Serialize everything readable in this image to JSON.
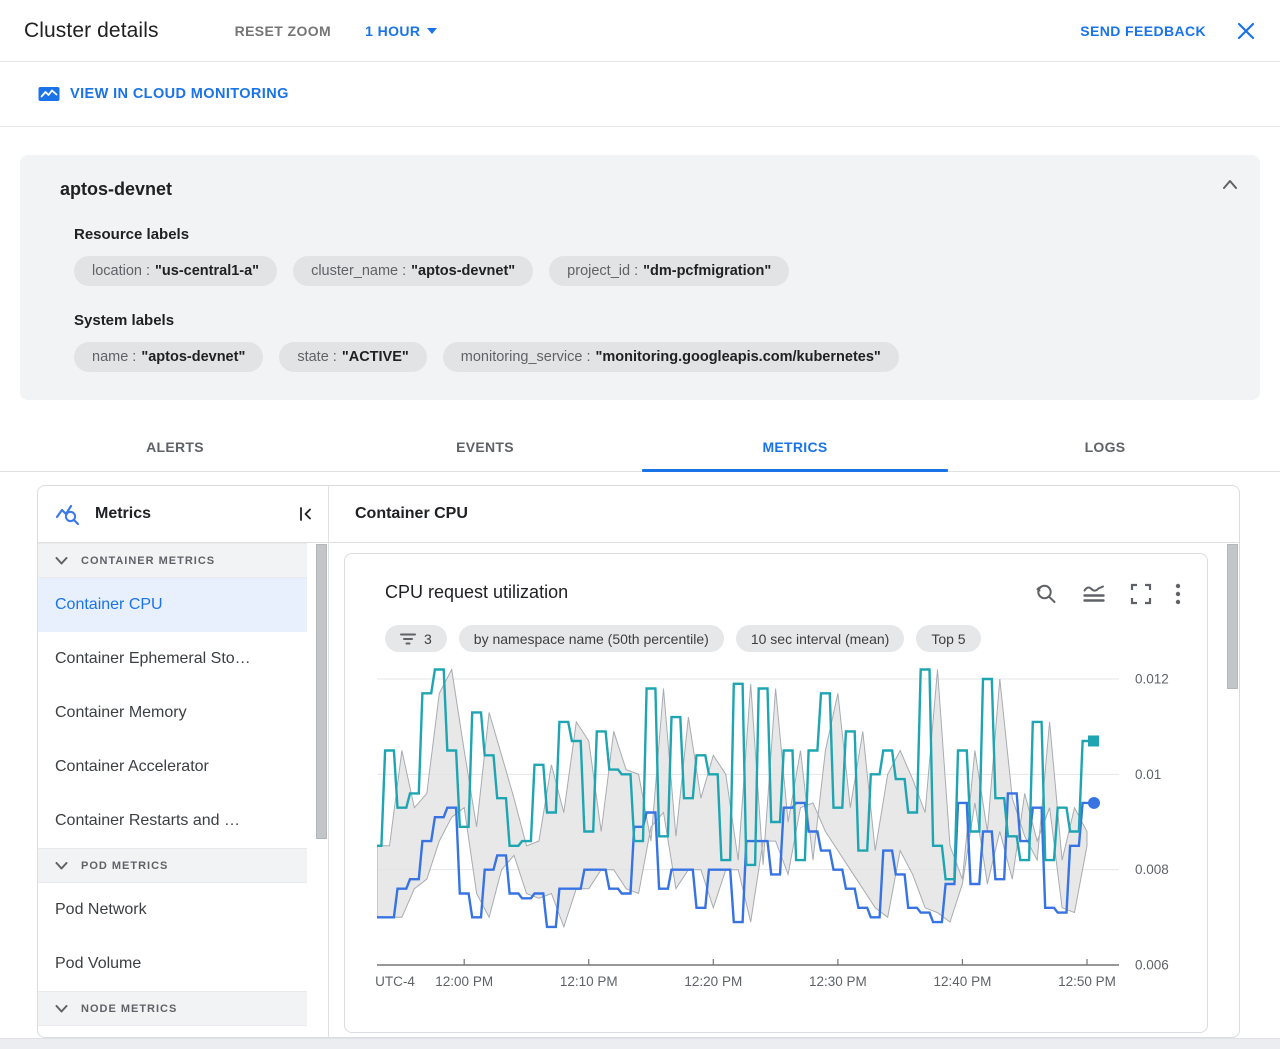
{
  "header": {
    "title": "Cluster details",
    "reset_zoom_label": "RESET ZOOM",
    "time_range_label": "1 HOUR",
    "send_feedback_label": "SEND FEEDBACK"
  },
  "monitoring_link": {
    "label": "VIEW IN CLOUD MONITORING"
  },
  "cluster_card": {
    "name": "aptos-devnet",
    "resource_labels_title": "Resource labels",
    "resource_labels": [
      {
        "key": "location",
        "value": "\"us-central1-a\""
      },
      {
        "key": "cluster_name",
        "value": "\"aptos-devnet\""
      },
      {
        "key": "project_id",
        "value": "\"dm-pcfmigration\""
      }
    ],
    "system_labels_title": "System labels",
    "system_labels": [
      {
        "key": "name",
        "value": "\"aptos-devnet\""
      },
      {
        "key": "state",
        "value": "\"ACTIVE\""
      },
      {
        "key": "monitoring_service",
        "value": "\"monitoring.googleapis.com/kubernetes\""
      }
    ]
  },
  "tabs": [
    {
      "label": "ALERTS",
      "active": false
    },
    {
      "label": "EVENTS",
      "active": false
    },
    {
      "label": "METRICS",
      "active": true
    },
    {
      "label": "LOGS",
      "active": false
    }
  ],
  "sidebar": {
    "title": "Metrics",
    "sections": [
      {
        "header": "CONTAINER METRICS",
        "items": [
          {
            "label": "Container CPU",
            "selected": true
          },
          {
            "label": "Container Ephemeral Sto…",
            "selected": false
          },
          {
            "label": "Container Memory",
            "selected": false
          },
          {
            "label": "Container Accelerator",
            "selected": false
          },
          {
            "label": "Container Restarts and …",
            "selected": false
          }
        ]
      },
      {
        "header": "POD METRICS",
        "items": [
          {
            "label": "Pod Network",
            "selected": false
          },
          {
            "label": "Pod Volume",
            "selected": false
          }
        ]
      },
      {
        "header": "NODE METRICS",
        "items": []
      }
    ]
  },
  "main": {
    "header": "Container CPU",
    "chart_card": {
      "title": "CPU request utilization",
      "toolbar_icons": [
        "zoom-reset",
        "chart-options",
        "fullscreen",
        "more-options"
      ],
      "chips": [
        {
          "icon": "filter",
          "label": "3"
        },
        {
          "icon": null,
          "label": "by namespace name (50th percentile)"
        },
        {
          "icon": null,
          "label": "10 sec interval (mean)"
        },
        {
          "icon": null,
          "label": "Top 5"
        }
      ]
    }
  },
  "chart_data": {
    "type": "line",
    "title": "CPU request utilization",
    "grid": true,
    "legend": "none",
    "x_axis": {
      "timezone_label": "UTC-4",
      "start_time": "11:53 AM",
      "interval_minutes": 1,
      "tick_minutes": [
        7,
        17,
        27,
        37,
        47,
        57
      ],
      "tick_labels": [
        "12:00 PM",
        "12:10 PM",
        "12:20 PM",
        "12:30 PM",
        "12:40 PM",
        "12:50 PM"
      ]
    },
    "y_axis": {
      "range": [
        0.006,
        0.0125
      ],
      "ticks": [
        0.006,
        0.008,
        0.01,
        0.012
      ],
      "tick_labels": [
        "0.006",
        "0.008",
        "0.01",
        "0.012"
      ]
    },
    "series": [
      {
        "name": "series-teal",
        "color": "#1fa5b2",
        "marker": "square",
        "values": [
          0.0085,
          0.0105,
          0.0093,
          0.0096,
          0.0117,
          0.0122,
          0.0105,
          0.0089,
          0.0113,
          0.0104,
          0.0095,
          0.0085,
          0.0086,
          0.0102,
          0.0092,
          0.0111,
          0.0107,
          0.0088,
          0.0109,
          0.0101,
          0.01,
          0.0086,
          0.0118,
          0.0087,
          0.0112,
          0.0095,
          0.0104,
          0.01,
          0.0082,
          0.0119,
          0.0081,
          0.0118,
          0.009,
          0.0105,
          0.0082,
          0.0105,
          0.0117,
          0.0093,
          0.0109,
          0.0084,
          0.01,
          0.0105,
          0.0099,
          0.0092,
          0.0122,
          0.0085,
          0.0078,
          0.0105,
          0.0088,
          0.012,
          0.0095,
          0.0087,
          0.0082,
          0.0111,
          0.0082,
          0.0093,
          0.0088,
          0.0107
        ]
      },
      {
        "name": "series-blue",
        "color": "#3873e3",
        "marker": "circle",
        "values": [
          0.007,
          0.007,
          0.0076,
          0.0078,
          0.0086,
          0.0091,
          0.0093,
          0.0075,
          0.007,
          0.008,
          0.0083,
          0.0075,
          0.0074,
          0.0075,
          0.0068,
          0.0076,
          0.0076,
          0.008,
          0.008,
          0.0076,
          0.0075,
          0.0089,
          0.0092,
          0.0076,
          0.008,
          0.008,
          0.0072,
          0.008,
          0.008,
          0.0069,
          0.0086,
          0.0086,
          0.0079,
          0.0093,
          0.0094,
          0.0088,
          0.0084,
          0.008,
          0.0076,
          0.0072,
          0.007,
          0.0084,
          0.0079,
          0.0072,
          0.0071,
          0.0069,
          0.0077,
          0.0094,
          0.0077,
          0.0088,
          0.0078,
          0.0096,
          0.0086,
          0.0093,
          0.0072,
          0.0071,
          0.0085,
          0.0094
        ]
      }
    ],
    "band": {
      "fill": "#e4e4e4",
      "stroke": "#9aa0a6",
      "upper": [
        0.0085,
        0.0085,
        0.0105,
        0.0093,
        0.0096,
        0.0117,
        0.0122,
        0.0105,
        0.0089,
        0.0113,
        0.0104,
        0.0095,
        0.0085,
        0.0086,
        0.0102,
        0.0092,
        0.0111,
        0.0107,
        0.0088,
        0.0109,
        0.0101,
        0.01,
        0.0086,
        0.0118,
        0.0087,
        0.0112,
        0.0095,
        0.0104,
        0.01,
        0.0082,
        0.0119,
        0.0081,
        0.0118,
        0.009,
        0.0105,
        0.0082,
        0.0105,
        0.0117,
        0.0093,
        0.0109,
        0.0084,
        0.01,
        0.0105,
        0.0099,
        0.0092,
        0.0122,
        0.0085,
        0.0078,
        0.0105,
        0.0088,
        0.012,
        0.0095,
        0.0087,
        0.0082,
        0.0111,
        0.0082,
        0.0093,
        0.0088
      ],
      "lower": [
        0.007,
        0.007,
        0.007,
        0.0076,
        0.0078,
        0.0086,
        0.0091,
        0.0093,
        0.0075,
        0.007,
        0.008,
        0.0083,
        0.0075,
        0.0074,
        0.0075,
        0.0068,
        0.0076,
        0.0076,
        0.008,
        0.008,
        0.0076,
        0.0075,
        0.0089,
        0.0092,
        0.0076,
        0.008,
        0.008,
        0.0072,
        0.008,
        0.008,
        0.0069,
        0.0086,
        0.0086,
        0.0079,
        0.0093,
        0.0094,
        0.0088,
        0.0084,
        0.008,
        0.0076,
        0.0072,
        0.007,
        0.0084,
        0.0079,
        0.0072,
        0.0071,
        0.0069,
        0.0077,
        0.0094,
        0.0077,
        0.0088,
        0.0078,
        0.0096,
        0.0086,
        0.0093,
        0.0072,
        0.0071,
        0.0085
      ]
    }
  },
  "colors": {
    "accent_blue": "#1a73e8",
    "teal_series": "#1fa5b2",
    "blue_series": "#3873e3"
  }
}
